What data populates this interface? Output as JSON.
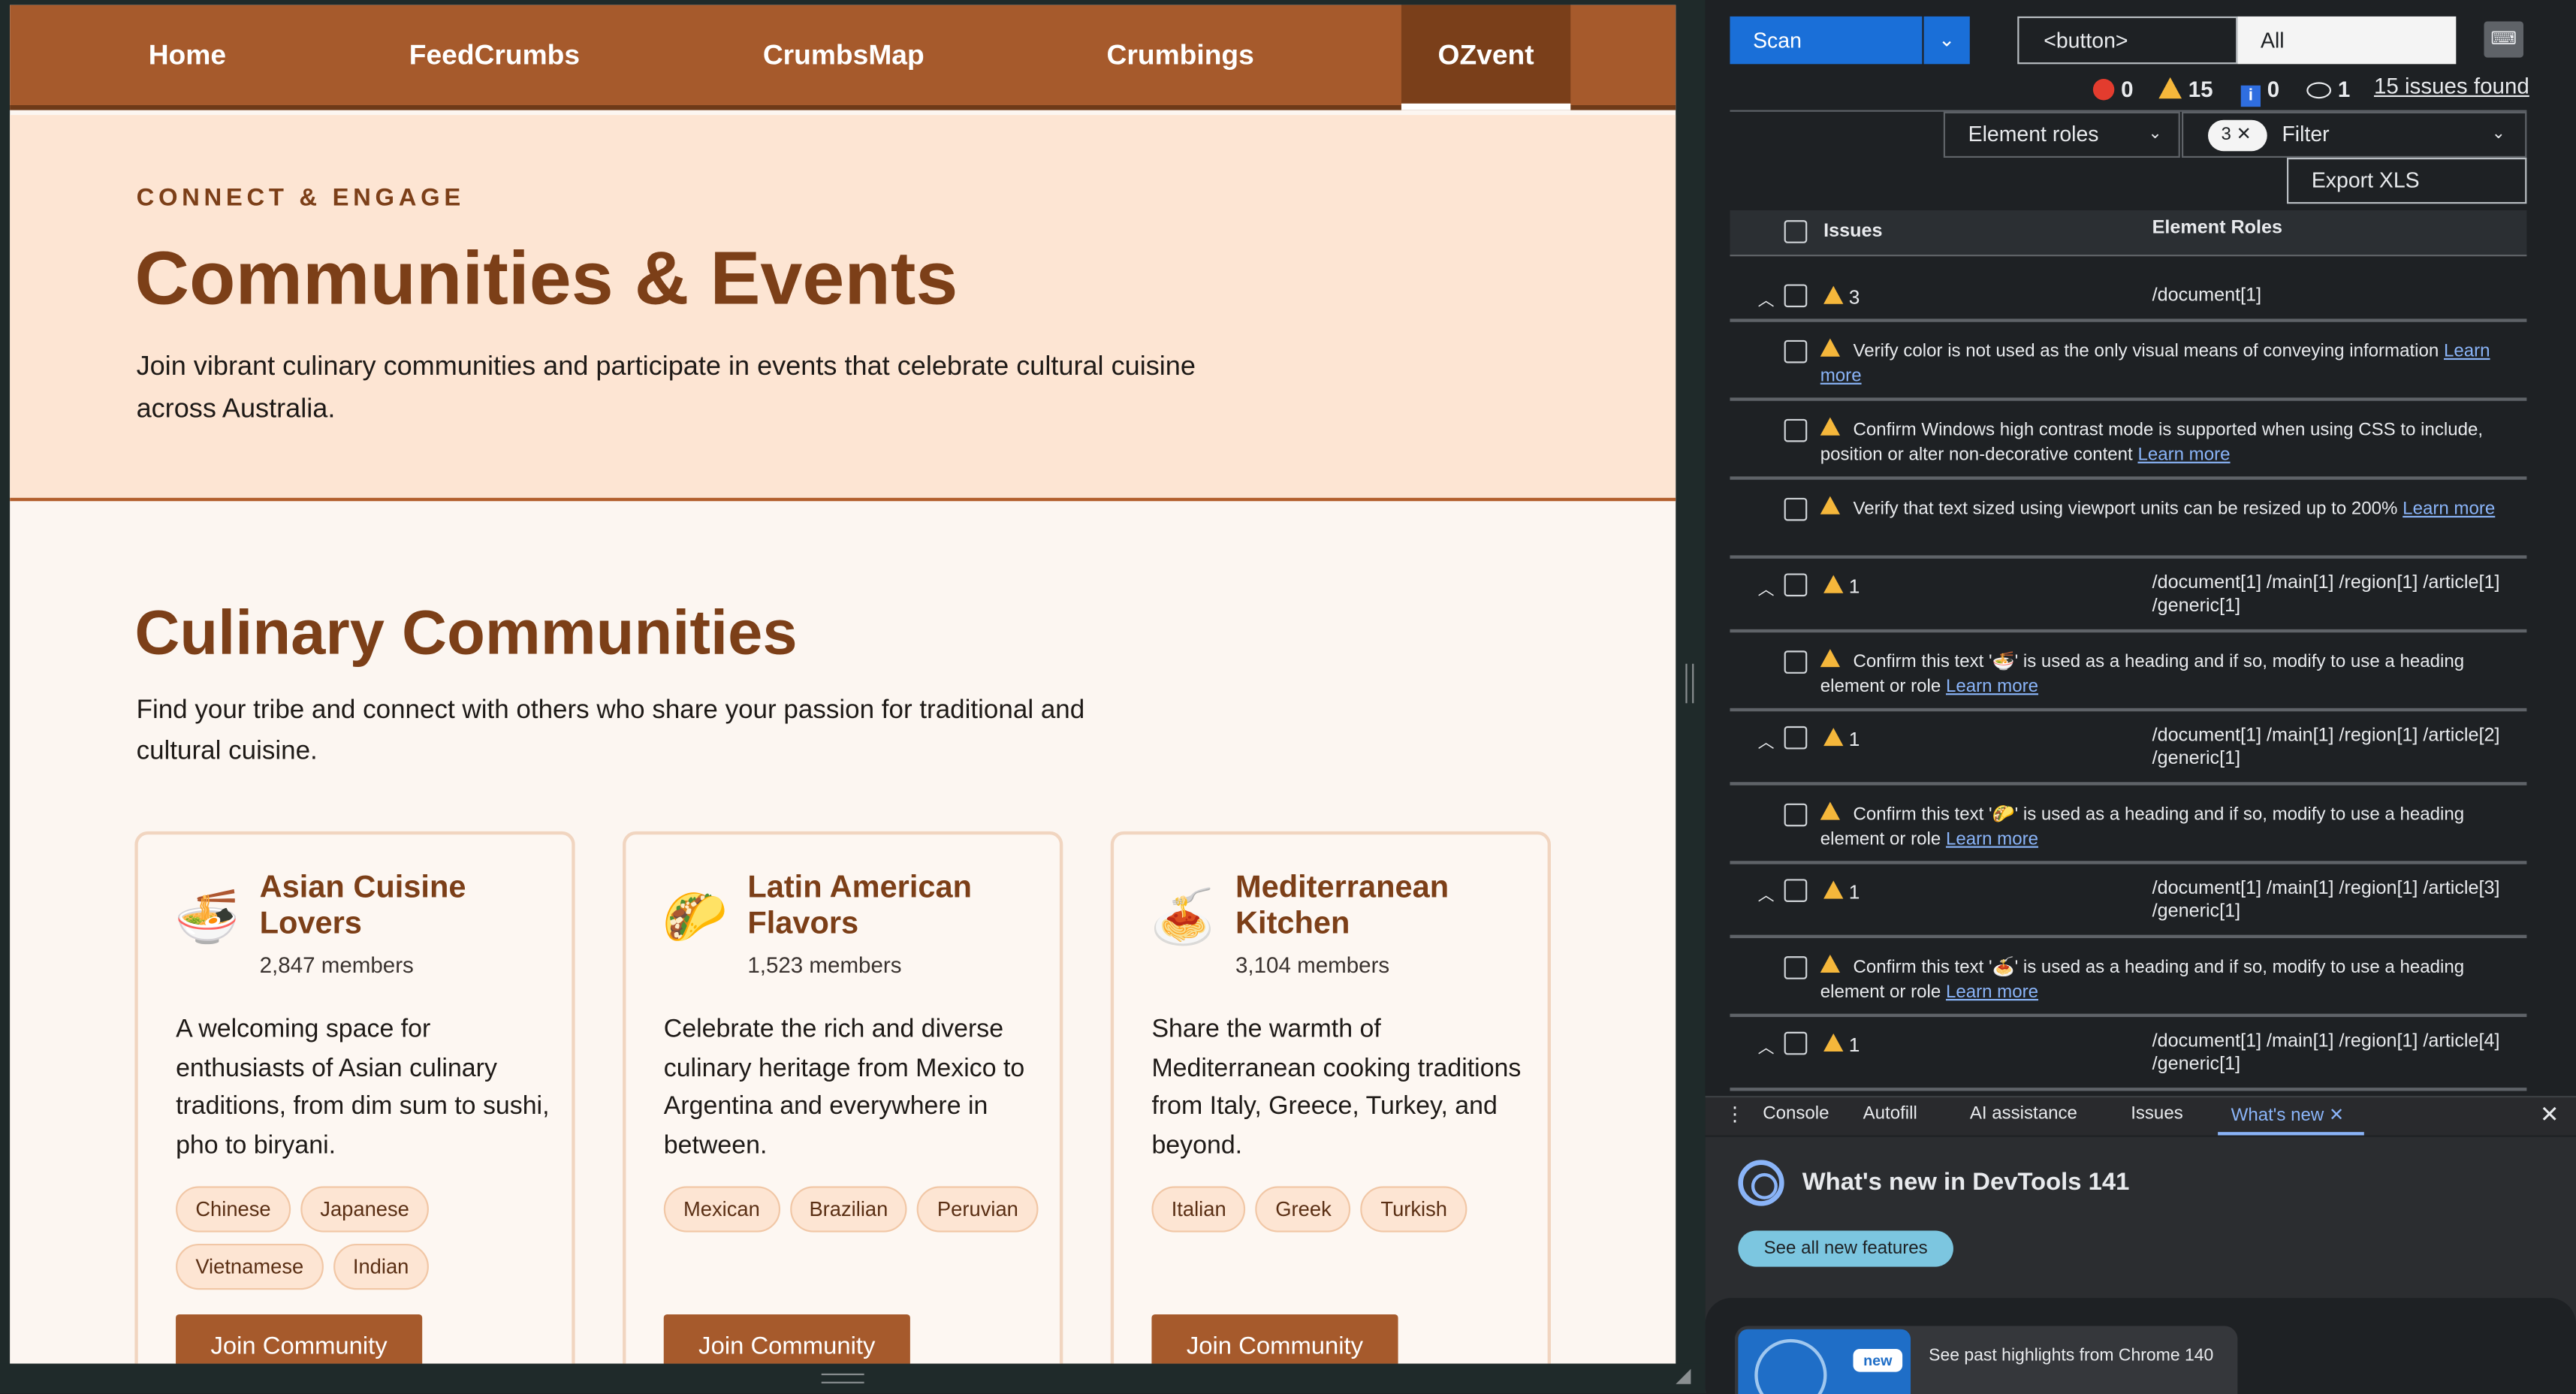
{
  "site": {
    "nav": [
      {
        "label": "Home",
        "active": false
      },
      {
        "label": "FeedCrumbs",
        "active": false
      },
      {
        "label": "CrumbsMap",
        "active": false
      },
      {
        "label": "Crumbings",
        "active": false
      },
      {
        "label": "OZvent",
        "active": true
      }
    ],
    "hero": {
      "eyebrow": "CONNECT & ENGAGE",
      "title": "Communities & Events",
      "description": "Join vibrant culinary communities and participate in events that celebrate cultural cuisine across Australia."
    },
    "section": {
      "title": "Culinary Communities",
      "description": "Find your tribe and connect with others who share your passion for traditional and cultural cuisine."
    },
    "cards": [
      {
        "emoji": "🍜",
        "title": "Asian Cuisine Lovers",
        "members": "2,847 members",
        "description": "A welcoming space for enthusiasts of Asian culinary traditions, from dim sum to sushi, pho to biryani.",
        "tags": [
          "Chinese",
          "Japanese",
          "Vietnamese",
          "Indian"
        ],
        "button": "Join Community"
      },
      {
        "emoji": "🌮",
        "title": "Latin American Flavors",
        "members": "1,523 members",
        "description": "Celebrate the rich and diverse culinary heritage from Mexico to Argentina and everywhere in between.",
        "tags": [
          "Mexican",
          "Brazilian",
          "Peruvian"
        ],
        "button": "Join Community"
      },
      {
        "emoji": "🍝",
        "title": "Mediterranean Kitchen",
        "members": "3,104 members",
        "description": "Share the warmth of Mediterranean cooking traditions from Italy, Greece, Turkey, and beyond.",
        "tags": [
          "Italian",
          "Greek",
          "Turkish"
        ],
        "button": "Join Community"
      }
    ]
  },
  "devtools": {
    "scan_label": "Scan",
    "selector_value": "<button>",
    "scope_value": "All",
    "counts": {
      "errors": "0",
      "warnings": "15",
      "info": "0",
      "hidden": "1"
    },
    "issues_found": "15 issues found",
    "roles_dropdown": "Element roles",
    "filter_chip": "3",
    "filter_label": "Filter",
    "export_label": "Export XLS",
    "table_headers": {
      "issues": "Issues",
      "roles": "Element Roles"
    },
    "groups": [
      {
        "count": "3",
        "path": "/document[1]",
        "items": [
          {
            "text": "Verify color is not used as the only visual means of conveying information",
            "link": "Learn more"
          },
          {
            "text": "Confirm Windows high contrast mode is supported when using CSS to include, position or alter non-decorative content",
            "link": "Learn more"
          },
          {
            "text": "Verify that text sized using viewport units can be resized up to 200%",
            "link": "Learn more"
          }
        ]
      },
      {
        "count": "1",
        "path": "/document[1] /main[1] /region[1] /article[1] /generic[1]",
        "items": [
          {
            "text": "Confirm this text '🍜' is used as a heading and if so, modify to use a heading element or role",
            "link": "Learn more"
          }
        ]
      },
      {
        "count": "1",
        "path": "/document[1] /main[1] /region[1] /article[2] /generic[1]",
        "items": [
          {
            "text": "Confirm this text '🌮' is used as a heading and if so, modify to use a heading element or role",
            "link": "Learn more"
          }
        ]
      },
      {
        "count": "1",
        "path": "/document[1] /main[1] /region[1] /article[3] /generic[1]",
        "items": [
          {
            "text": "Confirm this text '🍝' is used as a heading and if so, modify to use a heading element or role",
            "link": "Learn more"
          }
        ]
      },
      {
        "count": "1",
        "path": "/document[1] /main[1] /region[1] /article[4] /generic[1]",
        "items": []
      }
    ],
    "drawer": {
      "tabs": [
        "Console",
        "Autofill",
        "AI assistance",
        "Issues",
        "What's new"
      ],
      "active_tab": "What's new",
      "title": "What's new in DevTools 141",
      "see_all": "See all new features",
      "highlight_badge": "new",
      "highlight_text": "See past highlights from Chrome 140"
    },
    "colors": {
      "scan": "#1a6fd8",
      "warning": "#f5b73b",
      "error": "#e33c2e",
      "link": "#8ab4f8"
    }
  }
}
